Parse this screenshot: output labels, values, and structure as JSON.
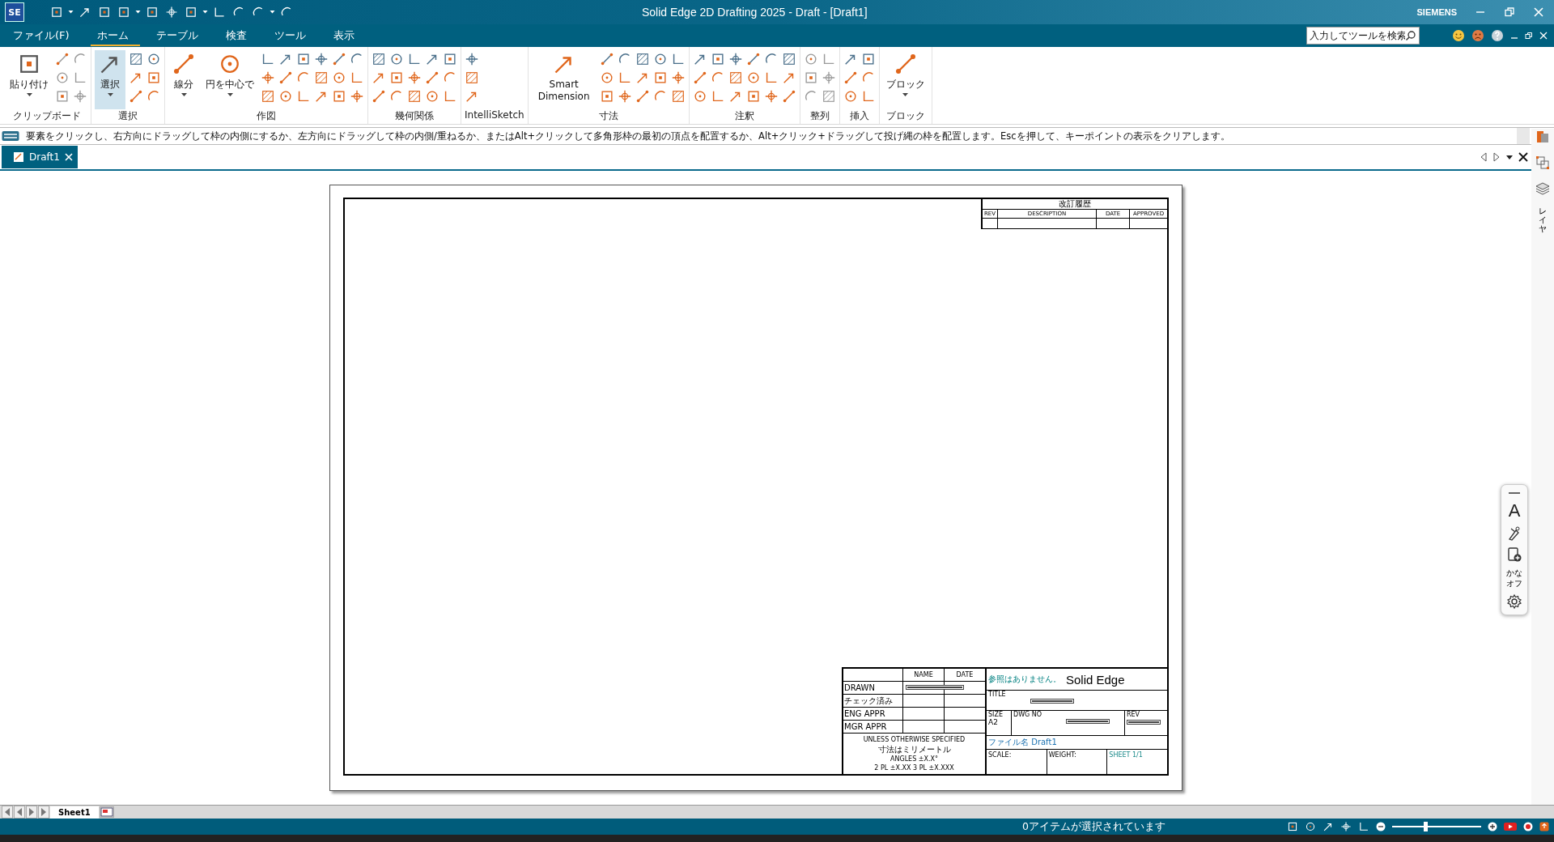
{
  "window": {
    "logo": "SE",
    "title": "Solid Edge 2D Drafting 2025 - Draft - [Draft1]",
    "brand": "SIEMENS"
  },
  "menu": [
    {
      "label": "ファイル(F)",
      "selected": false
    },
    {
      "label": "ホーム",
      "selected": true
    },
    {
      "label": "テーブル",
      "selected": false
    },
    {
      "label": "検査",
      "selected": false
    },
    {
      "label": "ツール",
      "selected": false
    },
    {
      "label": "表示",
      "selected": false
    }
  ],
  "search": {
    "placeholder": "入力してツールを検索"
  },
  "ribbon": [
    {
      "label": "クリップボード",
      "buttons": [
        {
          "label": "貼り付け",
          "selected": false,
          "dropdown": true
        }
      ]
    },
    {
      "label": "選択",
      "buttons": [
        {
          "label": "選択",
          "selected": true,
          "dropdown": true
        }
      ]
    },
    {
      "label": "作図",
      "buttons": [
        {
          "label": "線分",
          "selected": false,
          "dropdown": true
        },
        {
          "label": "円を中心で",
          "selected": false,
          "dropdown": true
        }
      ]
    },
    {
      "label": "幾何関係"
    },
    {
      "label": "IntelliSketch"
    },
    {
      "label": "寸法",
      "buttons": [
        {
          "label": "Smart Dimension",
          "selected": false,
          "dropdown": false
        }
      ]
    },
    {
      "label": "注釈"
    },
    {
      "label": "整列"
    },
    {
      "label": "挿入"
    },
    {
      "label": "ブロック",
      "buttons": [
        {
          "label": "ブロック",
          "selected": false,
          "dropdown": true
        }
      ]
    }
  ],
  "prompt": "要素をクリックし、右方向にドラッグして枠の内側にするか、左方向にドラッグして枠の内側/重ねるか、またはAlt+クリックして多角形枠の最初の頂点を配置するか、Alt+クリック+ドラッグして投げ縄の枠を配置します。Escを押して、キーポイントの表示をクリアします。",
  "doc_tabs": [
    {
      "label": "Draft1",
      "selected": true
    }
  ],
  "revision_block": {
    "title": "改訂履歴",
    "columns": [
      "REV",
      "DESCRIPTION",
      "DATE",
      "APPROVED"
    ]
  },
  "title_block": {
    "columns": [
      "NAME",
      "DATE"
    ],
    "rows": [
      "DRAWN",
      "チェック済み",
      "ENG APPR",
      "MGR APPR"
    ],
    "notes": [
      "UNLESS OTHERWISE SPECIFIED",
      "寸法はミリメートル",
      "ANGLES ±X.X°",
      "2 PL ±X.XX 3 PL ±X.XXX"
    ],
    "error": "参照はありません。",
    "company": "Solid Edge",
    "title_label": "TITLE",
    "size_label": "SIZE",
    "size": "A2",
    "dwg_no_label": "DWG NO",
    "rev_label": "REV",
    "file_name": "ファイル名 Draft1",
    "scale_label": "SCALE:",
    "weight_label": "WEIGHT:",
    "sheet": "SHEET 1/1"
  },
  "sheet_tabs": [
    {
      "label": "Sheet1",
      "selected": true
    }
  ],
  "side_panel": {
    "layers": "レイヤ"
  },
  "floating_toolbar": {
    "font": "A",
    "kana": "かなオフ"
  },
  "status_bar": {
    "message": "0アイテムが選択されています",
    "zoom": {
      "level": 0.37
    }
  }
}
